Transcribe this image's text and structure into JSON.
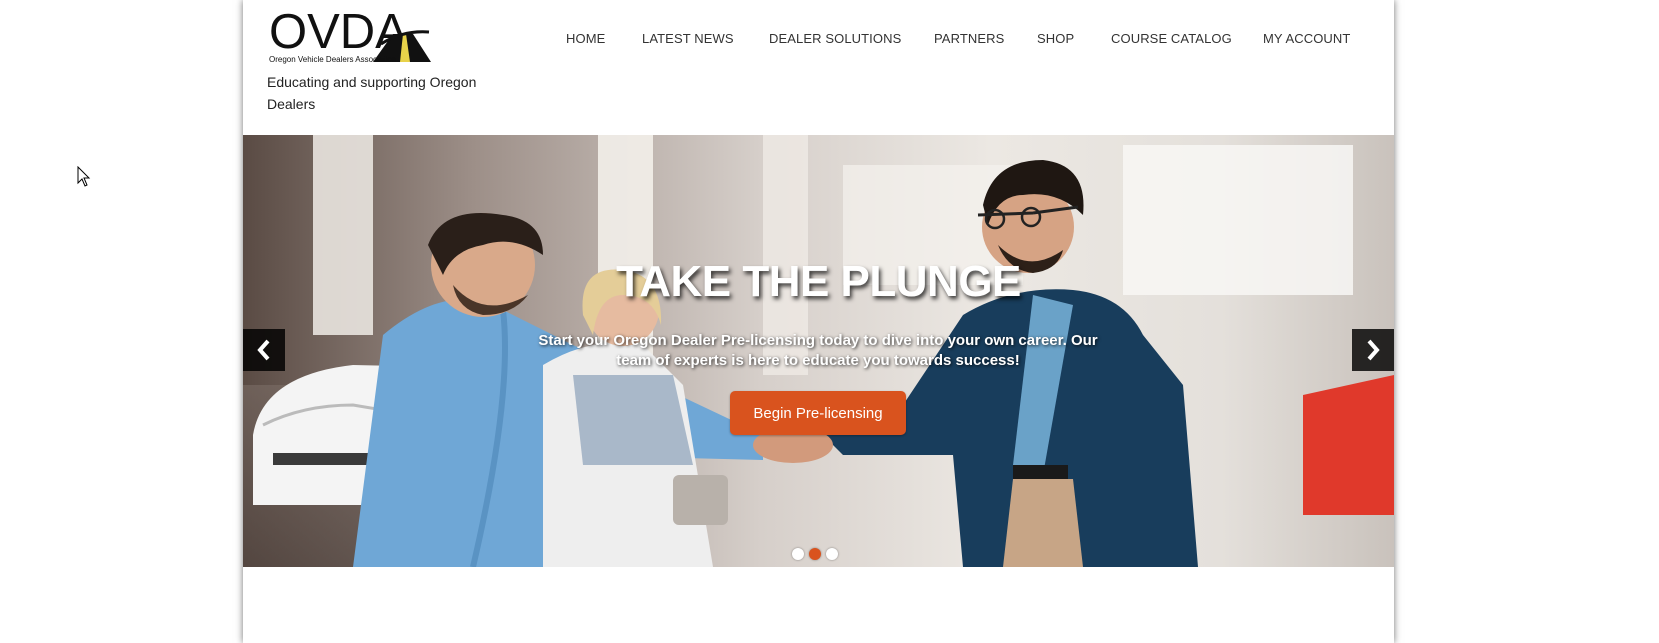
{
  "logo": {
    "word": "OVDA",
    "subtitle": "Oregon Vehicle Dealers Association"
  },
  "tagline": "Educating and supporting Oregon Dealers",
  "nav": [
    {
      "label": "HOME"
    },
    {
      "label": "LATEST NEWS"
    },
    {
      "label": "DEALER SOLUTIONS"
    },
    {
      "label": "PARTNERS"
    },
    {
      "label": "SHOP"
    },
    {
      "label": "COURSE CATALOG"
    },
    {
      "label": "MY ACCOUNT"
    }
  ],
  "hero": {
    "title": "TAKE THE PLUNGE",
    "text": "Start your Oregon Dealer Pre-licensing today to dive into your own career. Our team of experts is here to educate you towards success!",
    "button": "Begin Pre-licensing",
    "prev_icon": "chevron-left-icon",
    "next_icon": "chevron-right-icon",
    "slide_count": 3,
    "active_slide": 2
  },
  "colors": {
    "accent": "#d9531e",
    "text": "#333333"
  }
}
